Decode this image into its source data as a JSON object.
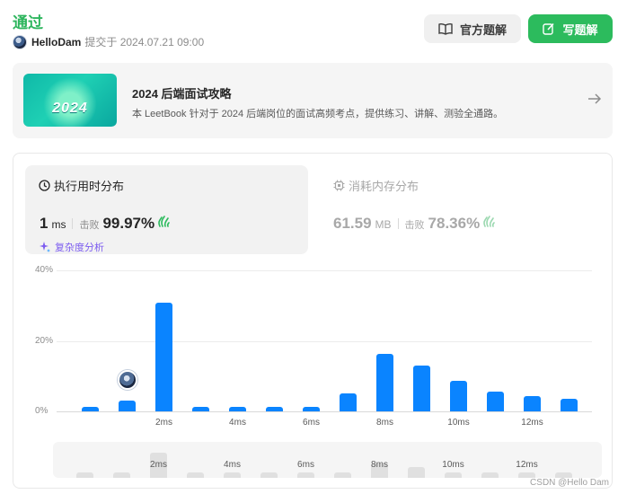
{
  "header": {
    "status": "通过",
    "username": "HelloDam",
    "submitted_label": "提交于 2024.07.21 09:00"
  },
  "buttons": {
    "official": "官方题解",
    "write": "写题解"
  },
  "banner": {
    "image_text": "2024",
    "title": "2024 后端面试攻略",
    "description": "本 LeetBook 针对于 2024 后端岗位的面试高频考点，提供练习、讲解、测验全通路。"
  },
  "runtime": {
    "heading": "执行用时分布",
    "value": "1",
    "unit": "ms",
    "beat_label": "击败",
    "beat_value": "99.97%",
    "complexity_link": "复杂度分析"
  },
  "memory": {
    "heading": "消耗内存分布",
    "value": "61.59",
    "unit": "MB",
    "beat_label": "击败",
    "beat_value": "78.36%"
  },
  "colors": {
    "accent_green": "#2cbb5d",
    "bar_blue": "#0a84ff",
    "purple_link": "#7c5cf0"
  },
  "chart_data": {
    "type": "bar",
    "ytick_labels": [
      "40%",
      "20%",
      "0%"
    ],
    "ylim": [
      0,
      40
    ],
    "xtick_labels": [
      "2ms",
      "4ms",
      "6ms",
      "8ms",
      "10ms",
      "12ms"
    ],
    "xtick_bar_index": [
      2,
      4,
      6,
      8,
      10,
      12
    ],
    "values": [
      1.3,
      3.0,
      30.8,
      1.3,
      1.3,
      1.3,
      1.3,
      5.2,
      16.3,
      13.0,
      8.6,
      5.6,
      4.3,
      3.6
    ],
    "highlight_index": 1,
    "grid": true,
    "mini_values": [
      6,
      6,
      28,
      6,
      6,
      6,
      6,
      6,
      16,
      12,
      6,
      6,
      6,
      6
    ]
  },
  "watermark": "CSDN @Hello Dam"
}
